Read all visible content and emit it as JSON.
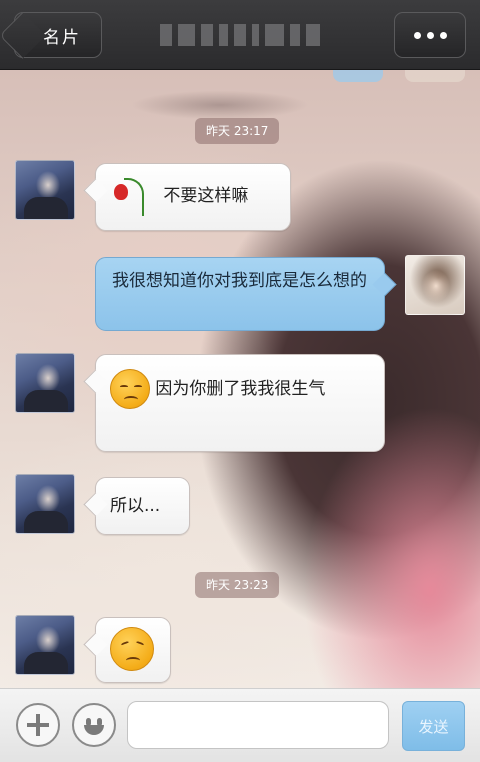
{
  "header": {
    "back_label": "名片"
  },
  "messages": {
    "ts1": "昨天 23:17",
    "m1": "不要这样嘛",
    "m2": "我很想知道你对我到底是怎么想的",
    "m3": "因为你删了我我很生气",
    "m4": "所以...",
    "ts2": "昨天 23:23"
  },
  "input": {
    "send_label": "发送",
    "value": ""
  },
  "colors": {
    "outgoing_bubble": "#99caee",
    "incoming_bubble": "#ffffff",
    "topbar": "#2b2b2d"
  },
  "icons": {
    "m1": "rose-icon",
    "m3": "sad-face-emoji",
    "m5": "worried-face-emoji"
  }
}
